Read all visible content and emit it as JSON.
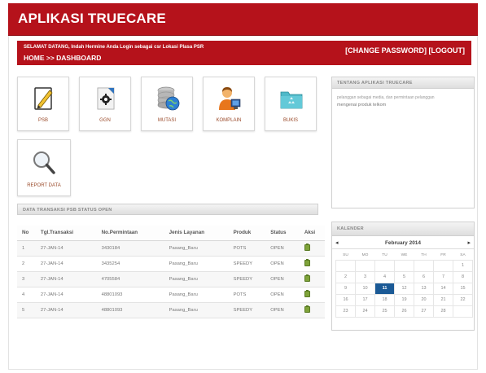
{
  "app": {
    "title": "APLIKASI TRUECARE"
  },
  "info": {
    "welcome": "SELAMAT DATANG, Indah Hermine    Anda Login sebagai csr    Lokasi Plasa PSR",
    "breadcrumb": "HOME >> DASHBOARD",
    "change_password": "[CHANGE PASSWORD]",
    "logout": "[LOGOUT]"
  },
  "tiles": [
    {
      "label": "PSB",
      "icon": "edit-document-icon"
    },
    {
      "label": "GGN",
      "icon": "gear-document-icon"
    },
    {
      "label": "MUTASI",
      "icon": "database-globe-icon"
    },
    {
      "label": "KOMPLAIN",
      "icon": "customer-service-icon"
    },
    {
      "label": "BUKIS",
      "icon": "folder-icon"
    },
    {
      "label": "REPORT DATA",
      "icon": "magnifier-icon"
    }
  ],
  "about": {
    "title": "TENTANG APLIKASI TRUECARE",
    "text1": "pelanggan sebagai media, dan permintaan pelanggan",
    "text2": "mengenai produk telkom"
  },
  "transactions": {
    "title": "DATA TRANSAKSI PSB STATUS OPEN",
    "headers": [
      "No",
      "Tgl.Transaksi",
      "No.Permintaan",
      "Jenis Layanan",
      "Produk",
      "Status",
      "Aksi"
    ],
    "rows": [
      [
        "1",
        "27-JAN-14",
        "3430184",
        "Pasang_Baru",
        "POTS",
        "OPEN"
      ],
      [
        "2",
        "27-JAN-14",
        "3435254",
        "Pasang_Baru",
        "SPEEDY",
        "OPEN"
      ],
      [
        "3",
        "27-JAN-14",
        "4705584",
        "Pasang_Baru",
        "SPEEDY",
        "OPEN"
      ],
      [
        "4",
        "27-JAN-14",
        "48801093",
        "Pasang_Baru",
        "POTS",
        "OPEN"
      ],
      [
        "5",
        "27-JAN-14",
        "48801093",
        "Pasang_Baru",
        "SPEEDY",
        "OPEN"
      ]
    ]
  },
  "calendar": {
    "title": "KALENDER",
    "month": "February 2014",
    "prev": "◂",
    "next": "▸",
    "weekdays": [
      "SU",
      "MO",
      "TU",
      "WE",
      "TH",
      "FR",
      "SA"
    ],
    "weeks": [
      [
        "",
        "",
        "",
        "",
        "",
        "",
        "1"
      ],
      [
        "2",
        "3",
        "4",
        "5",
        "6",
        "7",
        "8"
      ],
      [
        "9",
        "10",
        "11",
        "12",
        "13",
        "14",
        "15"
      ],
      [
        "16",
        "17",
        "18",
        "19",
        "20",
        "21",
        "22"
      ],
      [
        "23",
        "24",
        "25",
        "26",
        "27",
        "28",
        ""
      ]
    ],
    "today": "11"
  },
  "colors": {
    "brand": "#b5121b",
    "calendar_today": "#1b5a96",
    "action_icon": "#7fa33a"
  }
}
